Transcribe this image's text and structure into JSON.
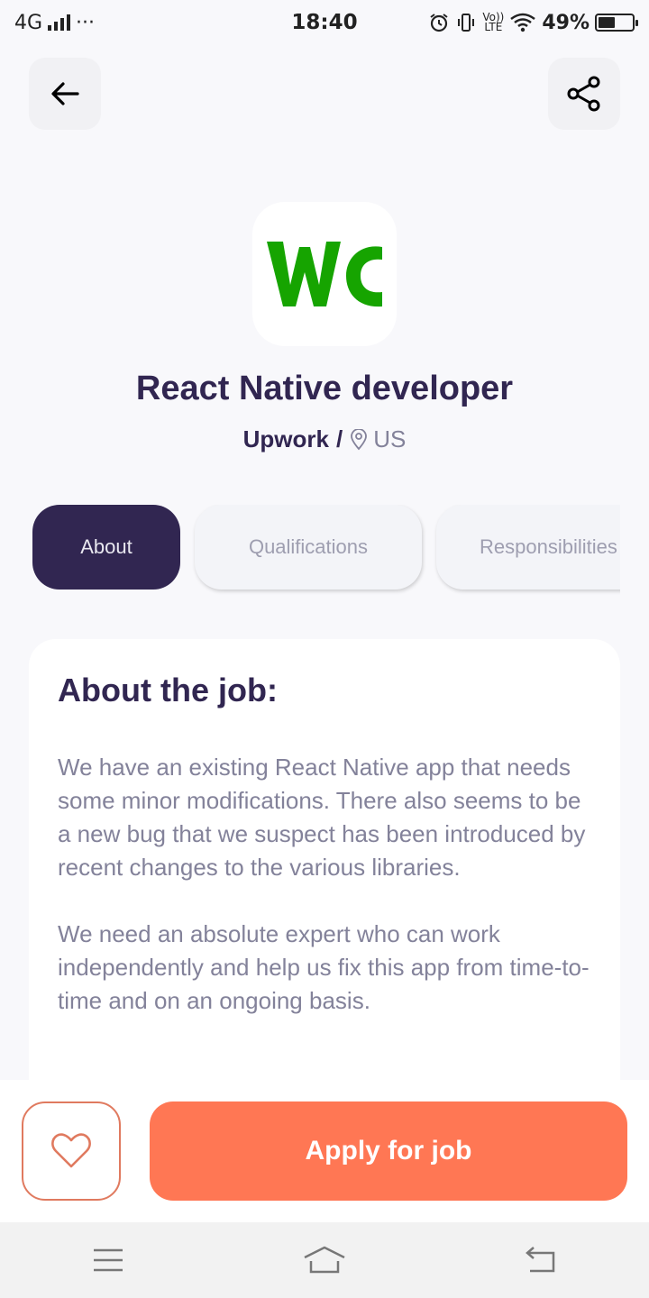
{
  "status_bar": {
    "network": "4G",
    "more": "···",
    "time": "18:40",
    "volte_top": "Vo))",
    "volte_bottom": "LTE",
    "battery": "49%",
    "battery_level": 0.49
  },
  "header": {
    "back_icon": "arrow-left-icon",
    "share_icon": "share-icon"
  },
  "company": {
    "logo_text": "WC",
    "logo_color": "#16a400",
    "name": "Upwork",
    "separator": "/",
    "location": "US"
  },
  "job": {
    "title": "React Native developer"
  },
  "tabs": [
    {
      "label": "About",
      "active": true
    },
    {
      "label": "Qualifications",
      "active": false
    },
    {
      "label": "Responsibilities",
      "active": false
    }
  ],
  "about": {
    "heading": "About the job:",
    "body": "We have an existing React Native app that needs some minor modifications. There also seems to be a new bug that we suspect has been introduced by recent changes to the various libraries.\n\nWe need an absolute expert who can work independently and help us fix this app from time-to-time and on an ongoing basis."
  },
  "footer": {
    "like_icon": "heart-outline-icon",
    "apply_label": "Apply for job"
  },
  "colors": {
    "primary": "#312651",
    "tertiary": "#ff7754",
    "gray": "#83829a",
    "background": "#f8f8fb"
  }
}
